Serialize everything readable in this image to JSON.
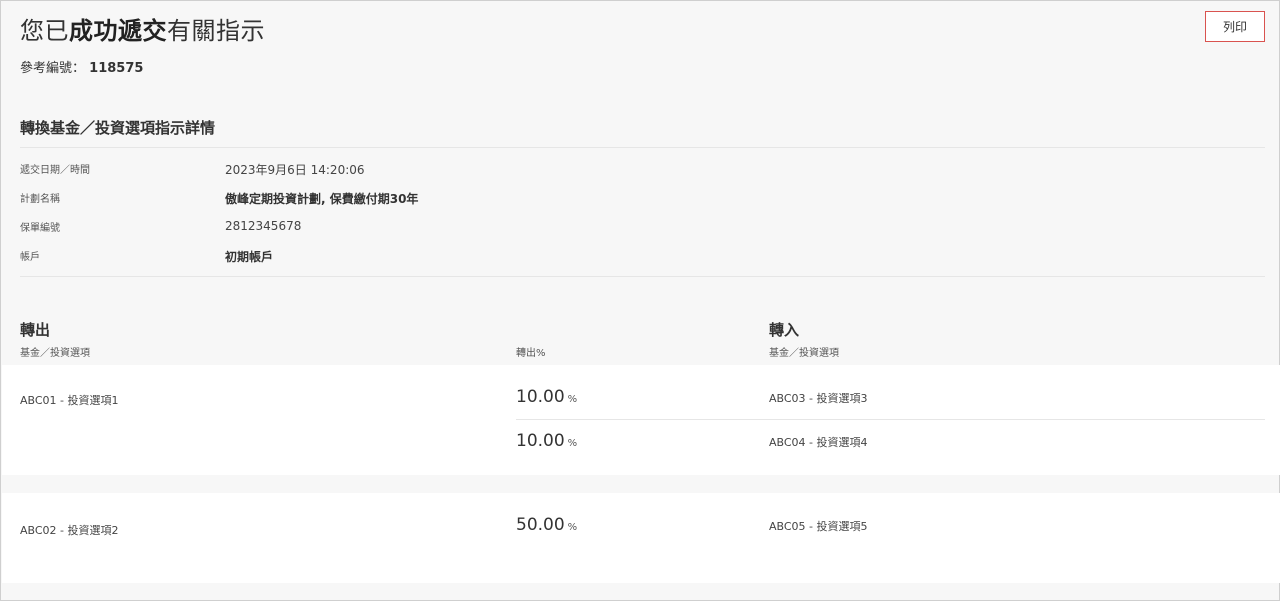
{
  "header": {
    "title_part1": "您已",
    "title_bold": "成功遞交",
    "title_part2": "有關指示",
    "print_label": "列印"
  },
  "reference": {
    "label": "參考編號：",
    "value": "118575"
  },
  "details": {
    "section_title": "轉換基金／投資選項指示詳情",
    "rows": [
      {
        "label": "遞交日期／時間",
        "value": "2023年9月6日 14:20:06"
      },
      {
        "label": "計劃名稱",
        "value": "傲峰定期投資計劃, 保費繳付期30年"
      },
      {
        "label": "保單編號",
        "value": "2812345678"
      },
      {
        "label": "帳戶",
        "value": "初期帳戶"
      }
    ]
  },
  "switch": {
    "out_heading": "轉出",
    "in_heading": "轉入",
    "out_fund_col": "基金／投資選項",
    "out_pct_col": "轉出%",
    "in_fund_col": "基金／投資選項",
    "pct_unit": "%",
    "groups": [
      {
        "from": "ABC01 - 投資選項1",
        "to": [
          {
            "pct": "10.00",
            "fund": "ABC03 - 投資選項3"
          },
          {
            "pct": "10.00",
            "fund": "ABC04 - 投資選項4"
          }
        ]
      },
      {
        "from": "ABC02 - 投資選項2",
        "to": [
          {
            "pct": "50.00",
            "fund": "ABC05 - 投資選項5"
          }
        ]
      }
    ]
  }
}
